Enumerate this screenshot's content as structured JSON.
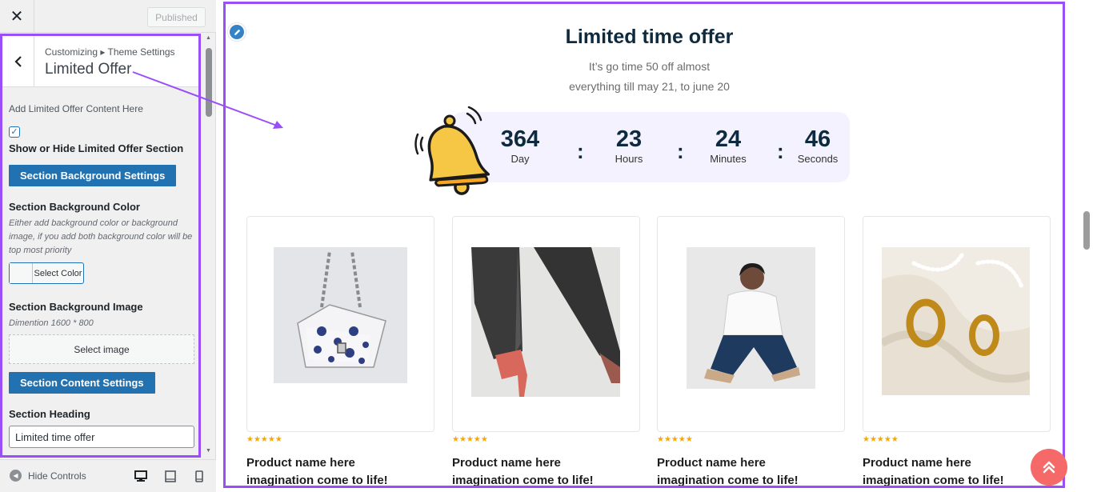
{
  "customizer": {
    "close_icon": "close-icon",
    "publish_label": "Published",
    "breadcrumb": "Customizing ▸ Theme Settings",
    "panel_title": "Limited Offer",
    "controls": {
      "intro": "Add Limited Offer Content Here",
      "show_hide_label": "Show or Hide Limited Offer Section",
      "show_hide_checked": true,
      "bg_settings_button": "Section Background Settings",
      "bg_color_label": "Section Background Color",
      "bg_color_desc": "Either add background color or background image, if you add both background color will be top most priority",
      "select_color": "Select Color",
      "bg_image_label": "Section Background Image",
      "bg_image_desc": "Dimention 1600 * 800",
      "select_image": "Select image",
      "content_settings_button": "Section Content Settings",
      "heading_label": "Section Heading",
      "heading_value": "Limited time offer"
    },
    "footer": {
      "hide_controls": "Hide Controls"
    }
  },
  "preview": {
    "heading": "Limited time offer",
    "subtitle_line1": "It’s go time 50 off almost",
    "subtitle_line2": "everything till may 21, to june 20",
    "countdown": {
      "days": "364",
      "days_label": "Day",
      "hours": "23",
      "hours_label": "Hours",
      "minutes": "24",
      "minutes_label": "Minutes",
      "seconds": "46",
      "seconds_label": "Seconds",
      "separator": ":"
    },
    "products": [
      {
        "stars": "★★★★★",
        "name_line1": "Product name here",
        "name_line2": "imagination come to life!"
      },
      {
        "stars": "★★★★★",
        "name_line1": "Product name here",
        "name_line2": "imagination come to life!"
      },
      {
        "stars": "★★★★★",
        "name_line1": "Product name here",
        "name_line2": "imagination come to life!"
      },
      {
        "stars": "★★★★★",
        "name_line1": "Product name here",
        "name_line2": "imagination come to life!"
      }
    ]
  },
  "colors": {
    "highlight": "#9a4ef7",
    "wp_blue": "#2271b1",
    "heading": "#0e2a3e",
    "countdown_bg": "#f4f2ff",
    "scroll_top": "#f56a68",
    "stars": "#f4a70b"
  }
}
